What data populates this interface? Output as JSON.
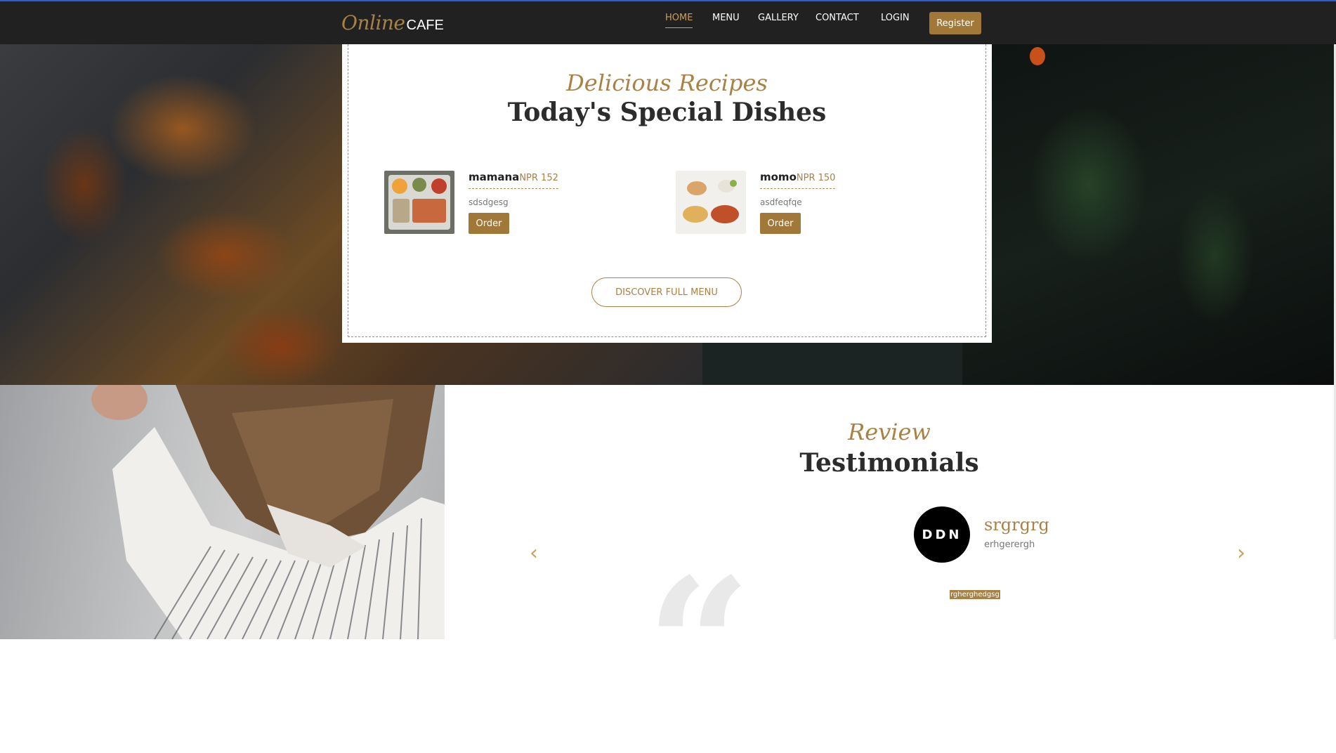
{
  "nav": {
    "logo_script": "Online",
    "logo_text": "CAFE",
    "items": [
      {
        "label": "HOME",
        "active": true
      },
      {
        "label": "MENU",
        "active": false
      },
      {
        "label": "GALLERY",
        "active": false
      },
      {
        "label": "CONTACT",
        "active": false
      },
      {
        "label": "LOGIN",
        "active": false
      }
    ],
    "register_label": "Register"
  },
  "specials": {
    "script_title": "Delicious Recipes",
    "title": "Today's Special Dishes",
    "dishes": [
      {
        "name": "mamana",
        "price": "NPR 152",
        "description": "sdsdgesg",
        "order_label": "Order"
      },
      {
        "name": "momo",
        "price": "NPR 150",
        "description": "asdfeqfqe",
        "order_label": "Order"
      }
    ],
    "discover_label": "DISCOVER FULL MENU"
  },
  "testimonials": {
    "script_title": "Review",
    "title": "Testimonials",
    "avatar_text": "DDN",
    "name": "srgrgrg",
    "role": "erhgerergh",
    "text": "rgherghedgsg",
    "prev_icon": "chevron-left-icon",
    "next_icon": "chevron-right-icon"
  },
  "colors": {
    "accent": "#a88245",
    "navbar": "#212121",
    "button": "#a27839"
  }
}
